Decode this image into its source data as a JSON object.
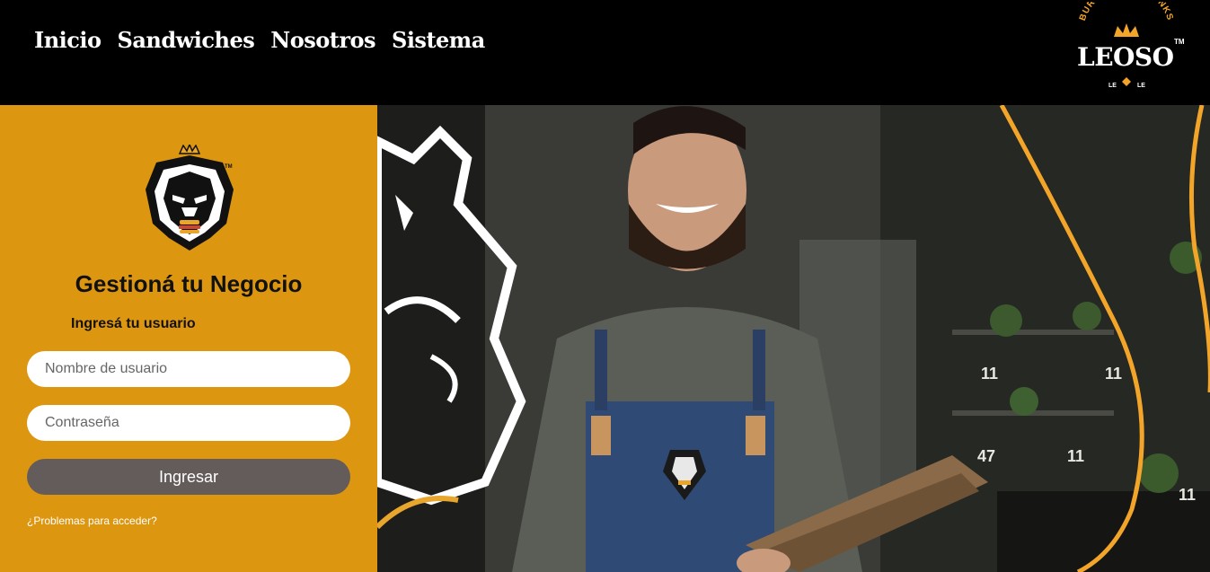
{
  "nav": {
    "items": [
      {
        "label": "Inicio"
      },
      {
        "label": "Sandwiches"
      },
      {
        "label": "Nosotros"
      },
      {
        "label": "Sistema"
      }
    ]
  },
  "brand": {
    "tagline": "BURGER AND DRINKS",
    "name": "LEOSO",
    "tm": "TM",
    "sub_left": "LE",
    "sub_right": "LE"
  },
  "login": {
    "emblem_tm": "TM",
    "title": "Gestioná tu Negocio",
    "subtitle": "Ingresá tu usuario",
    "username_placeholder": "Nombre de usuario",
    "password_placeholder": "Contraseña",
    "submit_label": "Ingresar",
    "help_link": "¿Problemas para acceder?"
  },
  "hero": {
    "numbers": [
      "11",
      "11",
      "47",
      "11",
      "11"
    ]
  },
  "colors": {
    "accent": "#DD960F",
    "button": "#645c5b",
    "topbar": "#000000"
  }
}
